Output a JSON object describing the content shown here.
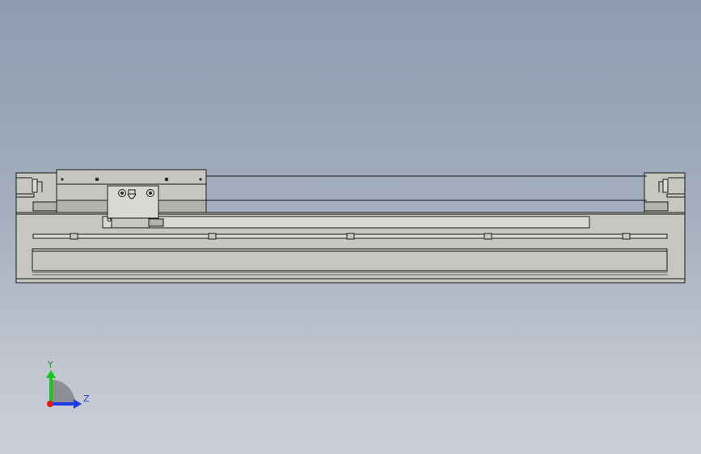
{
  "triad": {
    "y_label": "Y",
    "z_label": "Z",
    "colors": {
      "y_axis": "#16c81a",
      "z_axis": "#1a3ce6",
      "x_axis": "#e01818",
      "y_label": "#1a9a1a",
      "z_label": "#1a3ce6"
    }
  },
  "model": {
    "colors": {
      "body": "#c6c6c2",
      "outline": "#1a1a1a",
      "background_top": "#8e9cb0",
      "background_bottom": "#cbcfd7"
    }
  }
}
